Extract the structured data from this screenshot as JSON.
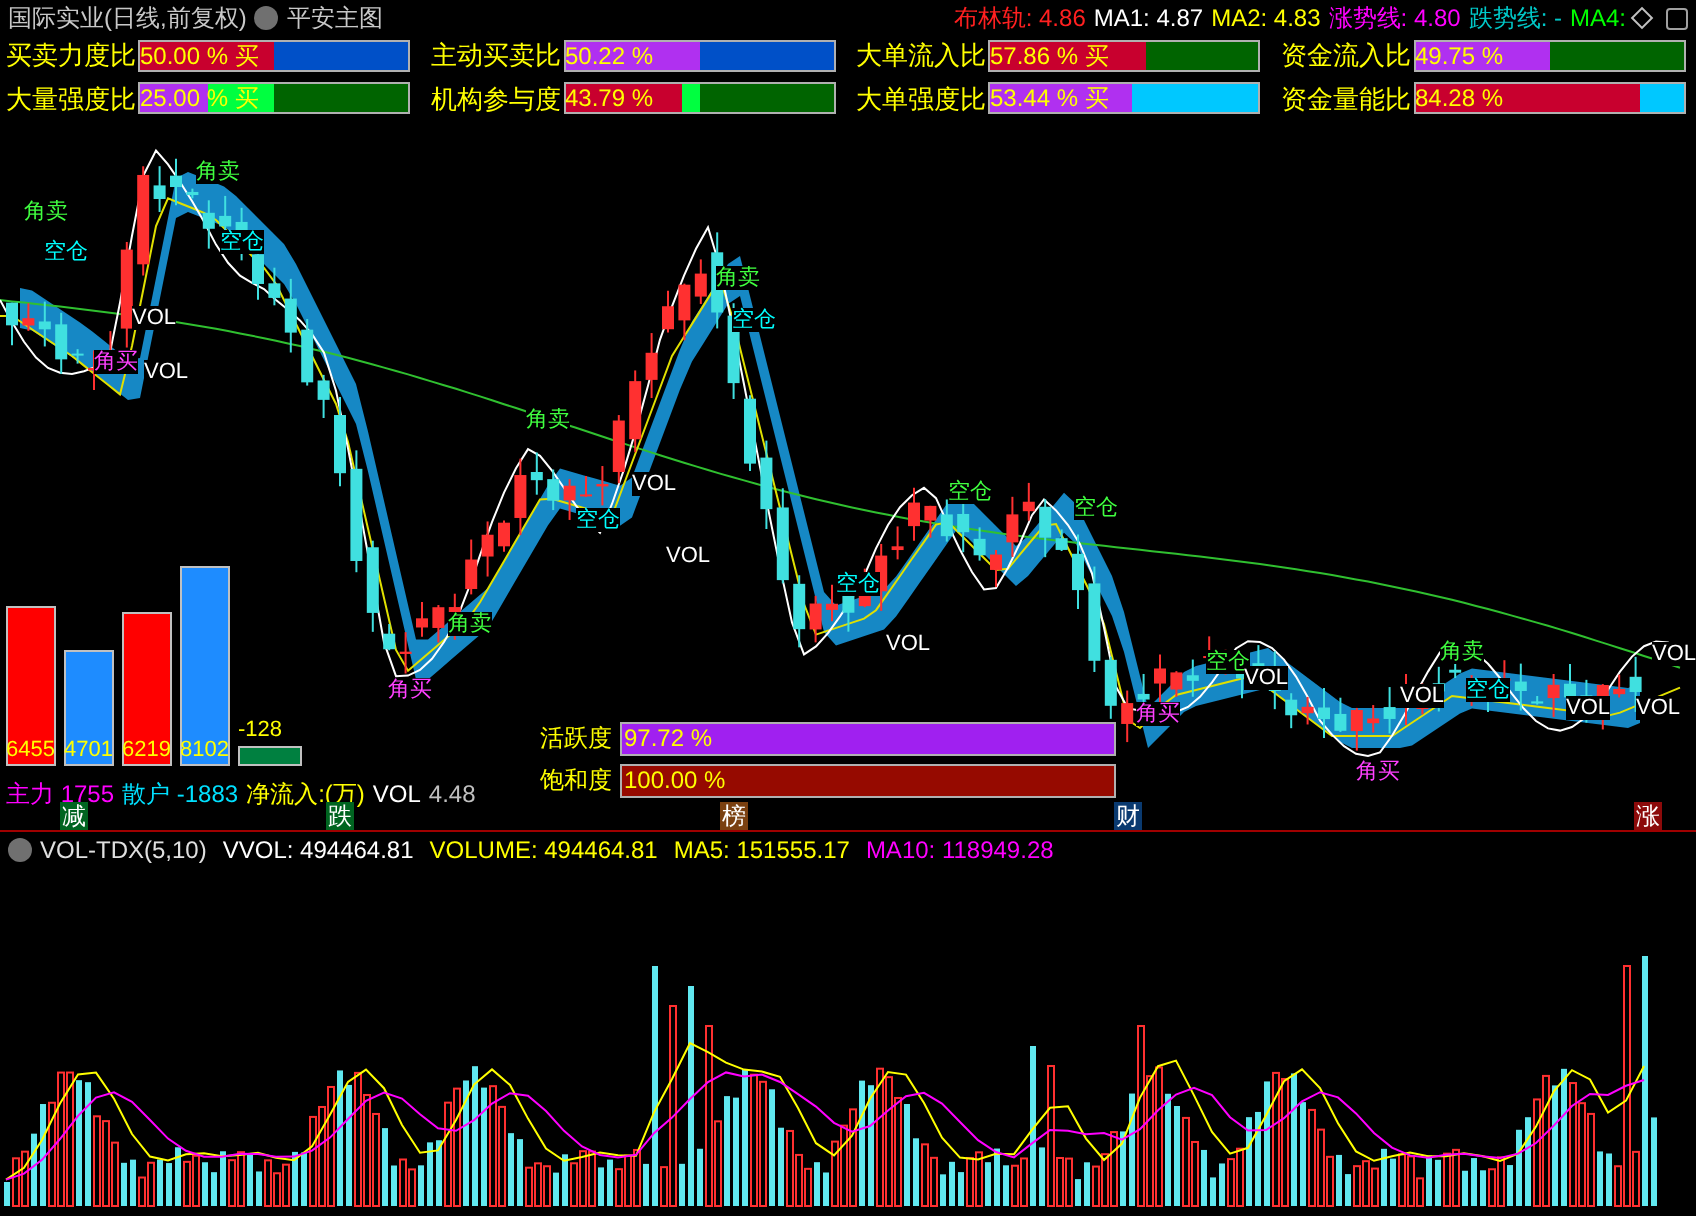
{
  "header": {
    "title": "国际实业(日线,前复权)",
    "indicator": "平安主图",
    "readings": [
      {
        "text": "布林轨: 4.86",
        "color": "#ff2020"
      },
      {
        "text": "MA1: 4.87",
        "color": "#ffffff"
      },
      {
        "text": "MA2: 4.83",
        "color": "#ffff00"
      },
      {
        "text": "涨势线: 4.80",
        "color": "#ff00ff"
      },
      {
        "text": "跌势线: -",
        "color": "#00c8c8"
      },
      {
        "text": "MA4:",
        "color": "#00ff00"
      }
    ]
  },
  "metrics": [
    {
      "label": "买卖力度比",
      "value": "50.00 % 买",
      "fills": [
        {
          "color": "#c8002e",
          "level": 0.5
        },
        {
          "color": "#0050c8",
          "level": 1
        }
      ]
    },
    {
      "label": "主动买卖比",
      "value": "50.22 %",
      "fills": [
        {
          "color": "#b030f0",
          "level": 0.5
        },
        {
          "color": "#0050c8",
          "level": 1
        }
      ]
    },
    {
      "label": "大单流入比",
      "value": "57.86 % 买",
      "fills": [
        {
          "color": "#c8002e",
          "level": 0.58
        },
        {
          "color": "#006400",
          "level": 1
        }
      ]
    },
    {
      "label": "资金流入比",
      "value": "49.75 %",
      "fills": [
        {
          "color": "#b030f0",
          "level": 0.5
        },
        {
          "color": "#006400",
          "level": 1
        }
      ]
    },
    {
      "label": "大量强度比",
      "value": "25.00 % 买",
      "fills": [
        {
          "color": "#b030f0",
          "level": 0.25
        },
        {
          "color": "#00ff40",
          "level": 0.5
        },
        {
          "color": "#006400",
          "level": 1
        }
      ]
    },
    {
      "label": "机构参与度",
      "value": "43.79 %",
      "fills": [
        {
          "color": "#c8002e",
          "level": 0.44
        },
        {
          "color": "#00ff40",
          "level": 0.5
        },
        {
          "color": "#006400",
          "level": 1
        }
      ]
    },
    {
      "label": "大单强度比",
      "value": "53.44 % 买",
      "fills": [
        {
          "color": "#b030f0",
          "level": 0.53
        },
        {
          "color": "#00c8ff",
          "level": 1
        }
      ]
    },
    {
      "label": "资金量能比",
      "value": "84.28 %",
      "fills": [
        {
          "color": "#c8002e",
          "level": 0.84
        },
        {
          "color": "#00c8ff",
          "level": 1
        }
      ]
    }
  ],
  "chart_labels": [
    {
      "text": "角卖",
      "kind": "sell"
    },
    {
      "text": "空仓",
      "kind": "empty"
    },
    {
      "text": "角买",
      "kind": "buy"
    },
    {
      "text": "VOL",
      "kind": "vol"
    },
    {
      "text": "VOL",
      "kind": "vol"
    },
    {
      "text": "角卖",
      "kind": "sell"
    },
    {
      "text": "空仓",
      "kind": "empty"
    },
    {
      "text": "角买",
      "kind": "buy"
    },
    {
      "text": "角卖",
      "kind": "sell"
    },
    {
      "text": "角卖",
      "kind": "sell"
    },
    {
      "text": "空仓",
      "kind": "empty"
    },
    {
      "text": "VOL",
      "kind": "vol"
    },
    {
      "text": "VOL",
      "kind": "vol"
    },
    {
      "text": "角卖",
      "kind": "sell"
    },
    {
      "text": "空仓",
      "kind": "empty"
    },
    {
      "text": "空仓",
      "kind": "empty"
    },
    {
      "text": "VOL",
      "kind": "vol"
    },
    {
      "text": "空仓",
      "kind": "sell"
    },
    {
      "text": "空仓",
      "kind": "sell"
    },
    {
      "text": "角买",
      "kind": "buy"
    },
    {
      "text": "空仓",
      "kind": "sell"
    },
    {
      "text": "VOL",
      "kind": "vol"
    },
    {
      "text": "角买",
      "kind": "buy"
    },
    {
      "text": "VOL",
      "kind": "vol"
    },
    {
      "text": "角卖",
      "kind": "sell"
    },
    {
      "text": "空仓",
      "kind": "empty"
    },
    {
      "text": "VOL",
      "kind": "vol"
    },
    {
      "text": "VOL",
      "kind": "vol"
    },
    {
      "text": "VOL",
      "kind": "vol"
    }
  ],
  "flow_bars": [
    {
      "value": "6455",
      "kind": "main"
    },
    {
      "value": "4701",
      "kind": "retail"
    },
    {
      "value": "6219",
      "kind": "main"
    },
    {
      "value": "8102",
      "kind": "retail"
    },
    {
      "value": "-128",
      "kind": "net"
    }
  ],
  "flow_summary": [
    {
      "text": "主力 1755",
      "color": "#ff00ff"
    },
    {
      "text": "散户 -1883",
      "color": "#00e0ff"
    },
    {
      "text": "净流入:(万)",
      "color": "#ffff00"
    },
    {
      "text": "VOL",
      "color": "#ffffff"
    },
    {
      "text": "4.48",
      "color": "#c0c0c0"
    }
  ],
  "gauges": [
    {
      "label": "活跃度",
      "value": "97.72 %",
      "level": 1,
      "color": "#a020f0"
    },
    {
      "label": "饱和度",
      "value": "100.00 %",
      "level": 1,
      "color": "#960a00"
    }
  ],
  "events": [
    {
      "text": "减",
      "color": "#006420"
    },
    {
      "text": "跌",
      "color": "#006420"
    },
    {
      "text": "榜",
      "color": "#7a4010"
    },
    {
      "text": "财",
      "color": "#0a3a70"
    },
    {
      "text": "涨",
      "color": "#8c0a0a"
    }
  ],
  "volume": {
    "name": "VOL-TDX(5,10)",
    "readings": [
      {
        "text": "VVOL: 494464.81",
        "color": "#ffffff"
      },
      {
        "text": "VOLUME: 494464.81",
        "color": "#ffff00"
      },
      {
        "text": "MA5: 151555.17",
        "color": "#ffff00"
      },
      {
        "text": "MA10: 118949.28",
        "color": "#ff00ff"
      }
    ]
  }
}
